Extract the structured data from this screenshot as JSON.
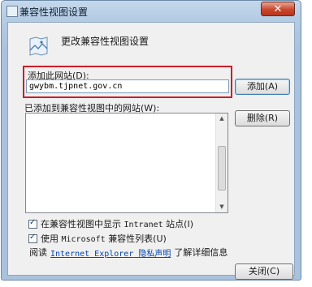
{
  "window": {
    "title": "兼容性视图设置",
    "close_symbol": "✕"
  },
  "header": {
    "icon": "compat-view-icon",
    "text": "更改兼容性视图设置"
  },
  "add_site": {
    "label": "添加此网站(D):",
    "value": "gwybm.tjpnet.gov.cn",
    "button": "添加(A)",
    "highlight_color": "#c8202a"
  },
  "site_list": {
    "label": "已添加到兼容性视图中的网站(W):",
    "items": [],
    "remove_button": "删除(R)"
  },
  "options": {
    "intranet_checked": true,
    "intranet_prefix": "在兼容性视图中显示",
    "intranet_mono": "Intranet",
    "intranet_suffix": "站点(I)",
    "mslist_checked": true,
    "mslist_prefix": "使用",
    "mslist_mono": "Microsoft",
    "mslist_suffix": "兼容性列表(U)"
  },
  "privacy": {
    "prefix": "阅读",
    "link_mono": "Internet Explorer",
    "link_text": "隐私声明",
    "suffix": "了解详细信息"
  },
  "footer": {
    "close_button": "关闭(C)"
  }
}
